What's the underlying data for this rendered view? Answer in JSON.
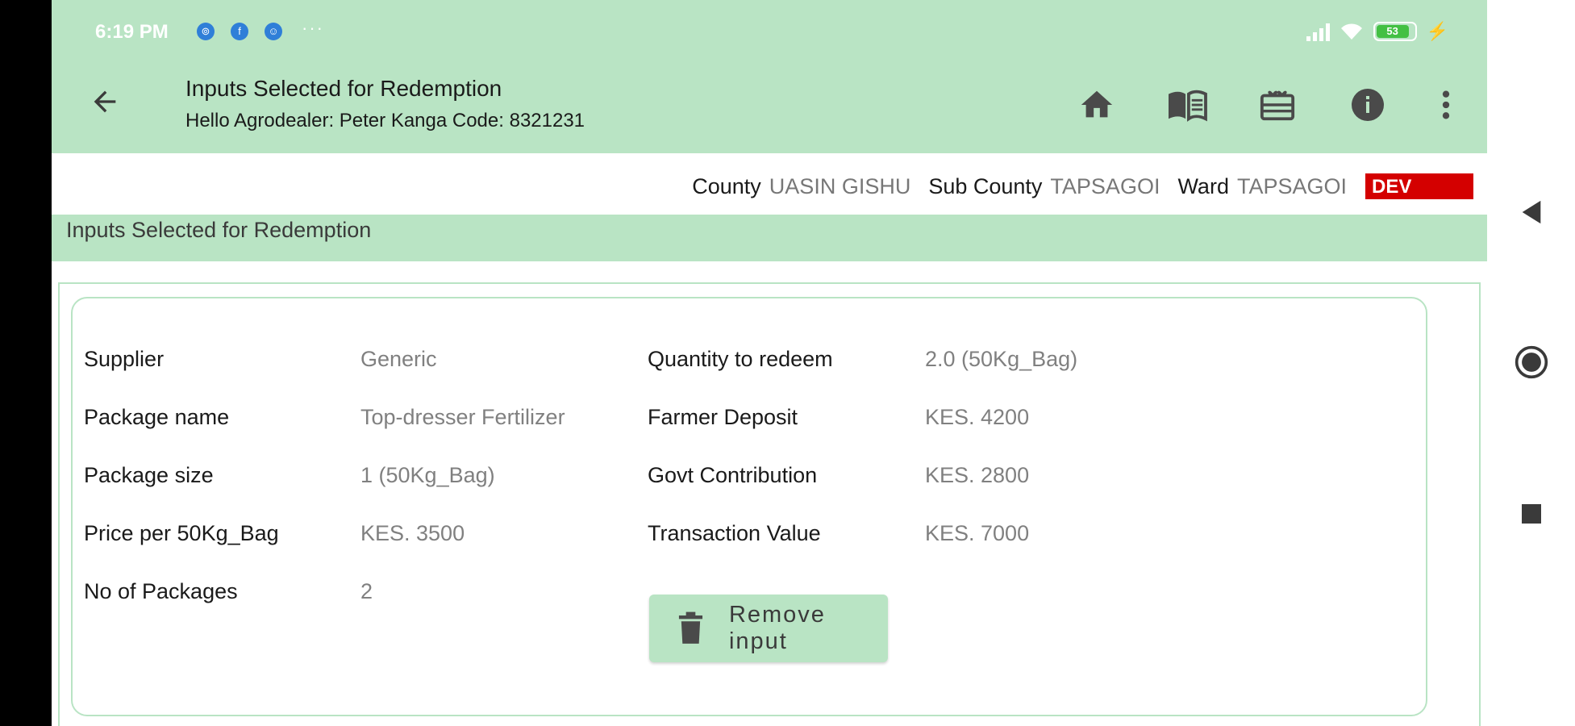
{
  "status_bar": {
    "time": "6:19 PM",
    "notifications": [
      "messenger-icon",
      "facebook-icon",
      "chat-icon"
    ],
    "dots": "···",
    "battery_level": "53"
  },
  "app_bar": {
    "title": "Inputs Selected for Redemption",
    "subtitle": "Hello Agrodealer: Peter Kanga Code: 8321231",
    "actions": [
      "home-icon",
      "book-icon",
      "gift-card-icon",
      "info-icon",
      "more-vertical-icon"
    ]
  },
  "location": {
    "county_label": "County",
    "county_value": "UASIN GISHU",
    "subcounty_label": "Sub County",
    "subcounty_value": "TAPSAGOI",
    "ward_label": "Ward",
    "ward_value": "TAPSAGOI",
    "env_badge": "DEV"
  },
  "section": {
    "title": "Inputs Selected for Redemption"
  },
  "item": {
    "supplier_label": "Supplier",
    "supplier_value": "Generic",
    "package_name_label": "Package name",
    "package_name_value": "Top-dresser Fertilizer",
    "package_size_label": "Package size",
    "package_size_value": "1 (50Kg_Bag)",
    "price_label": "Price per 50Kg_Bag",
    "price_value": "KES. 3500",
    "packages_label": "No of Packages",
    "packages_value": "2",
    "quantity_label": "Quantity to redeem",
    "quantity_value": "2.0 (50Kg_Bag)",
    "deposit_label": "Farmer Deposit",
    "deposit_value": "KES. 4200",
    "govt_label": "Govt Contribution",
    "govt_value": "KES. 2800",
    "transaction_label": "Transaction Value",
    "transaction_value": "KES. 7000",
    "remove_label": "Remove input"
  },
  "colors": {
    "accent": "#b9e4c4",
    "badge": "#d40000"
  }
}
